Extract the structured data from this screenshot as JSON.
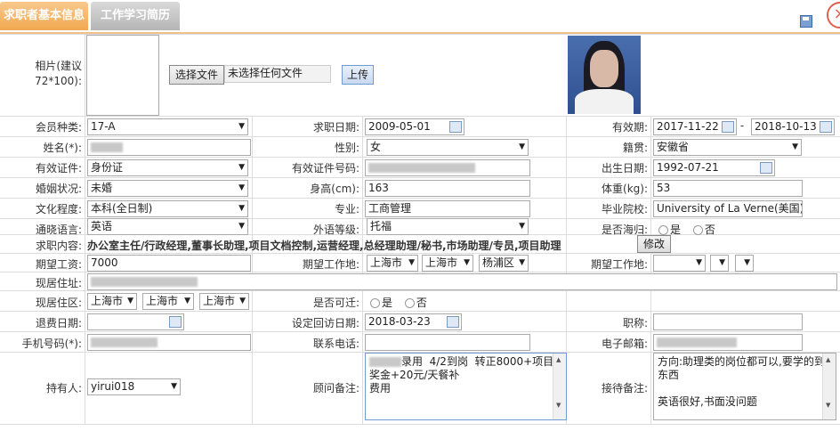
{
  "tabs": [
    {
      "label": "求职者基本信息"
    },
    {
      "label": "工作学习简历"
    }
  ],
  "close_label": "×",
  "photo": {
    "label": "相片(建议72*100):",
    "choose_file": "选择文件",
    "no_file": "未选择任何文件",
    "upload": "上传"
  },
  "rows": {
    "member_type": {
      "label": "会员种类:",
      "value": "17-A"
    },
    "job_date": {
      "label": "求职日期:",
      "value": "2009-05-01"
    },
    "valid_period": {
      "label": "有效期:",
      "start": "2017-11-22",
      "sep": "-",
      "end": "2018-10-13"
    },
    "name": {
      "label": "姓名(*):"
    },
    "gender": {
      "label": "性别:",
      "value": "女"
    },
    "hometown": {
      "label": "籍贯:",
      "value": "安徽省"
    },
    "id_type": {
      "label": "有效证件:",
      "value": "身份证"
    },
    "id_no": {
      "label": "有效证件号码:"
    },
    "birth": {
      "label": "出生日期:",
      "value": "1992-07-21"
    },
    "marital": {
      "label": "婚姻状况:",
      "value": "未婚"
    },
    "height": {
      "label": "身高(cm):",
      "value": "163"
    },
    "weight": {
      "label": "体重(kg):",
      "value": "53"
    },
    "education": {
      "label": "文化程度:",
      "value": "本科(全日制)"
    },
    "major": {
      "label": "专业:",
      "value": "工商管理"
    },
    "school": {
      "label": "毕业院校:",
      "value": "University of La Verne(美国)大学"
    },
    "language": {
      "label": "通晓语言:",
      "value": "英语"
    },
    "lang_level": {
      "label": "外语等级:",
      "value": "托福"
    },
    "overseas": {
      "label": "是否海归:",
      "yes": "是",
      "no": "否"
    },
    "job_content": {
      "label": "求职内容:",
      "value": "办公室主任/行政经理,董事长助理,项目文档控制,运营经理,总经理助理/秘书,市场助理/专员,项目助理",
      "edit": "修改"
    },
    "salary": {
      "label": "期望工资:",
      "value": "7000"
    },
    "work_place": {
      "label": "期望工作地:",
      "city": "上海市",
      "district_city": "上海市",
      "district": "杨浦区"
    },
    "work_place2": {
      "label": "期望工作地:"
    },
    "address": {
      "label": "现居住址:"
    },
    "residence": {
      "label": "现居住区:",
      "a": "上海市",
      "b": "上海市",
      "c": "上海市"
    },
    "relocate": {
      "label": "是否可迁:",
      "yes": "是",
      "no": "否"
    },
    "refund_date": {
      "label": "退费日期:"
    },
    "revisit_date": {
      "label": "设定回访日期:",
      "value": "2018-03-23"
    },
    "title": {
      "label": "职称:"
    },
    "mobile": {
      "label": "手机号码(*):"
    },
    "phone": {
      "label": "联系电话:"
    },
    "email": {
      "label": "电子邮箱:"
    },
    "holder": {
      "label": "持有人:",
      "value": "yirui018"
    },
    "consultant_note": {
      "label": "顾问备注:",
      "text": "录用  4/2到岗  转正8000+项目奖金+20元/天餐补\n费用"
    },
    "reception_note": {
      "label": "接待备注:",
      "text": "方向:助理类的岗位都可以,要学的到东西\n\n英语很好,书面没问题"
    }
  }
}
